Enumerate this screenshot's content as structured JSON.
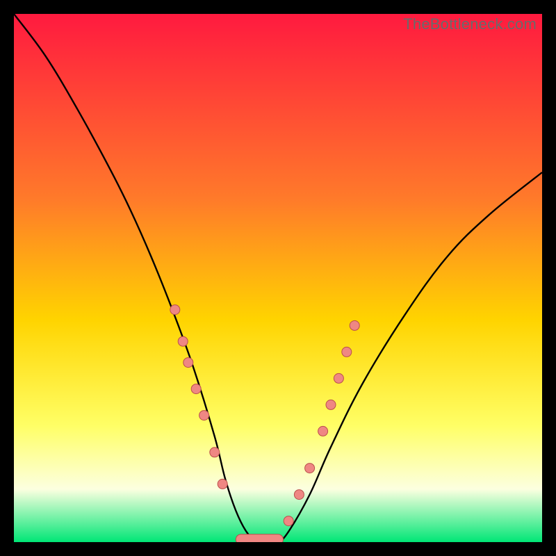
{
  "watermark": "TheBottleneck.com",
  "colors": {
    "marker_fill": "#ef8783",
    "marker_stroke": "#ba4f4b",
    "curve_stroke": "#000000",
    "gradient_top": "#ff1a3f",
    "gradient_mid1": "#ff7a2a",
    "gradient_mid2": "#ffd400",
    "gradient_mid3": "#ffff66",
    "gradient_mid4": "#fcffe0",
    "gradient_bottom": "#00e676",
    "frame_bg": "#000000"
  },
  "chart_data": {
    "type": "line",
    "title": "",
    "xlabel": "",
    "ylabel": "",
    "xlim": [
      0,
      100
    ],
    "ylim": [
      0,
      100
    ],
    "y_inverted_display": true,
    "series": [
      {
        "name": "bottleneck-curve",
        "x": [
          0,
          6,
          12,
          18,
          22,
          26,
          30,
          34,
          38,
          40,
          42,
          44,
          46,
          48,
          50,
          52,
          56,
          60,
          66,
          74,
          82,
          90,
          100
        ],
        "y": [
          100,
          92,
          82,
          71,
          63,
          54,
          44,
          33,
          20,
          12,
          6,
          2,
          0,
          0,
          0,
          2,
          9,
          18,
          30,
          43,
          54,
          62,
          70
        ]
      }
    ],
    "markers_left": [
      {
        "x": 30.5,
        "y": 44
      },
      {
        "x": 32.0,
        "y": 38
      },
      {
        "x": 33.0,
        "y": 34
      },
      {
        "x": 34.5,
        "y": 29
      },
      {
        "x": 36.0,
        "y": 24
      },
      {
        "x": 38.0,
        "y": 17
      },
      {
        "x": 39.5,
        "y": 11
      }
    ],
    "markers_right": [
      {
        "x": 52.0,
        "y": 4
      },
      {
        "x": 54.0,
        "y": 9
      },
      {
        "x": 56.0,
        "y": 14
      },
      {
        "x": 58.5,
        "y": 21
      },
      {
        "x": 60.0,
        "y": 26
      },
      {
        "x": 61.5,
        "y": 31
      },
      {
        "x": 63.0,
        "y": 36
      },
      {
        "x": 64.5,
        "y": 41
      }
    ],
    "flat_segment": {
      "x_start": 43,
      "x_end": 50,
      "y": 0.5
    }
  }
}
